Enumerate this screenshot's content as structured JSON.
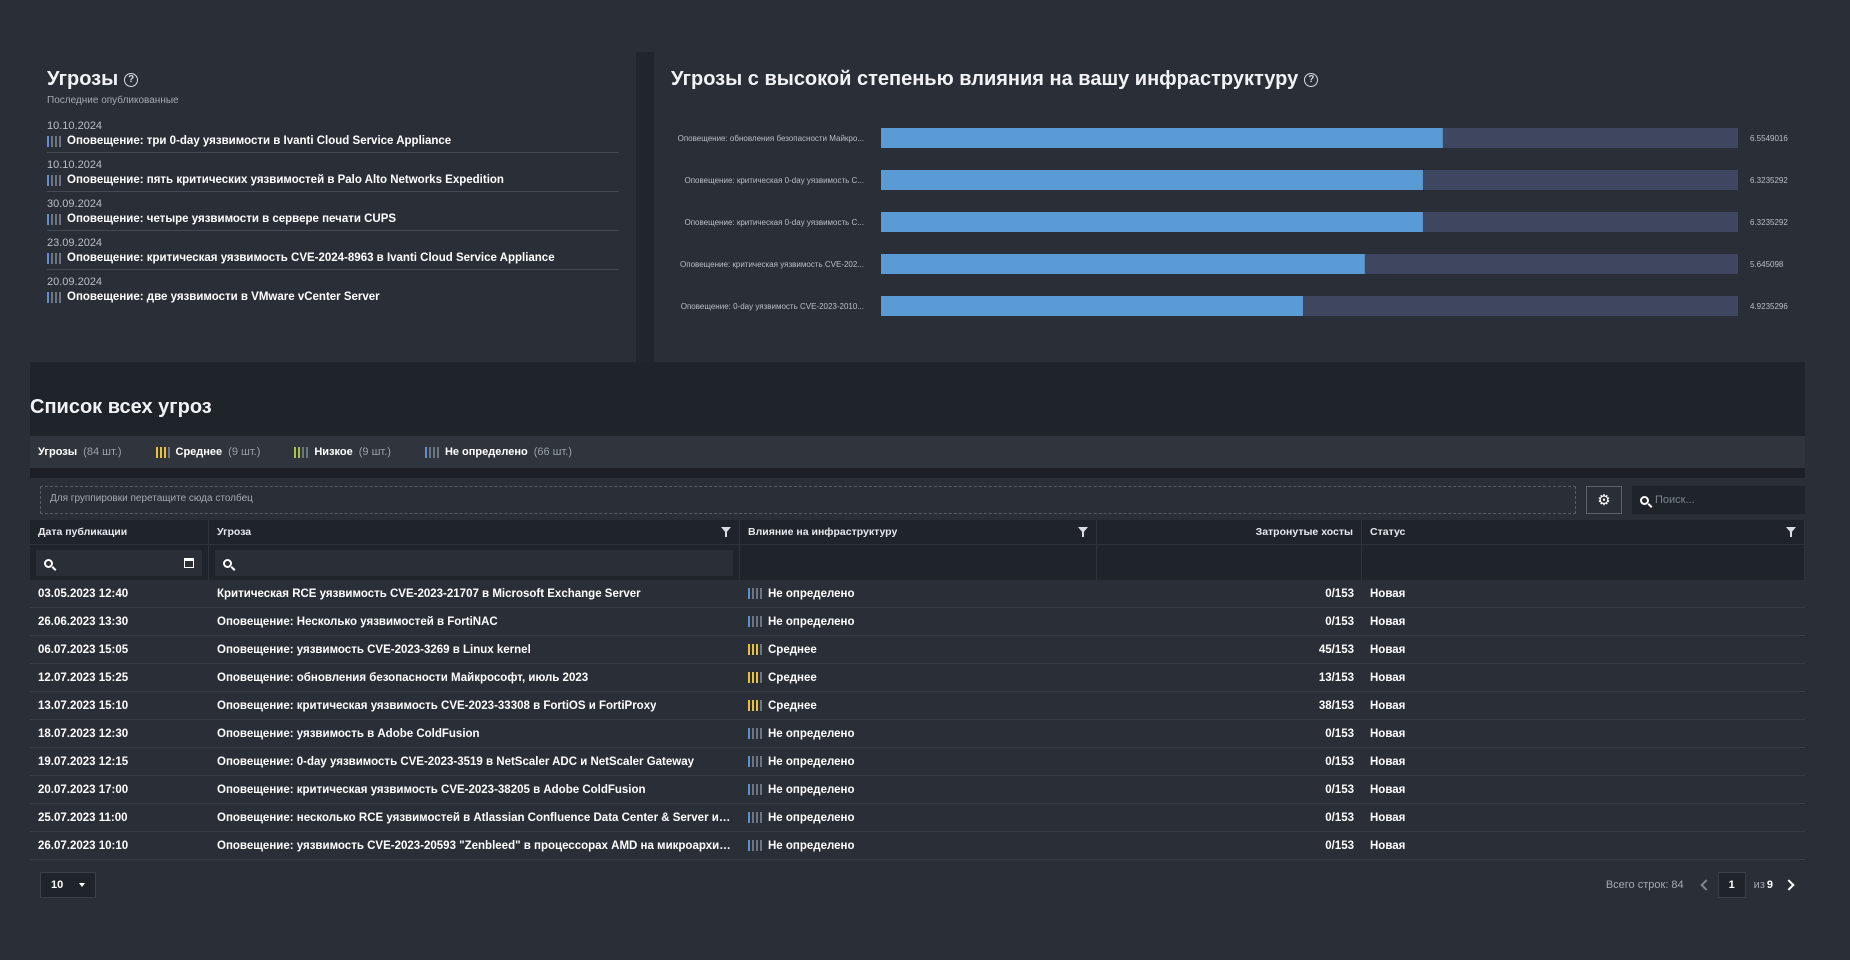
{
  "threats_panel": {
    "title": "Угрозы",
    "subtitle": "Последние опубликованные",
    "items": [
      {
        "date": "10.10.2024",
        "title": "Оповещение: три 0-day уязвимости в Ivanti Cloud Service Appliance"
      },
      {
        "date": "10.10.2024",
        "title": "Оповещение: пять критических уязвимостей в Palo Alto Networks Expedition"
      },
      {
        "date": "30.09.2024",
        "title": "Оповещение: четыре уязвимости в сервере печати CUPS"
      },
      {
        "date": "23.09.2024",
        "title": "Оповещение: критическая уязвимость CVE-2024-8963 в Ivanti Cloud Service Appliance"
      },
      {
        "date": "20.09.2024",
        "title": "Оповещение: две уязвимости в VMware vCenter Server"
      }
    ]
  },
  "chart_panel": {
    "title": "Угрозы с высокой степенью влияния на вашу инфраструктуру"
  },
  "chart_data": {
    "type": "bar",
    "orientation": "horizontal",
    "categories": [
      "Оповещение: обновления безопасности Майкро...",
      "Оповещение: критическая 0-day уязвимость C...",
      "Оповещение: критическая 0-day уязвимость C...",
      "Оповещение: критическая уязвимость CVE-202...",
      "Оповещение: 0-day уязвимость CVE-2023-2010..."
    ],
    "values": [
      6.5549016,
      6.3235292,
      6.3235292,
      5.645098,
      4.9235296
    ],
    "value_labels": [
      "6.5549016",
      "6.3235292",
      "6.3235292",
      "5.645098",
      "4.9235296"
    ],
    "xlim": [
      0,
      10
    ],
    "colors": {
      "bar": "#5b9bd5",
      "track": "#3e4660"
    }
  },
  "list": {
    "title": "Список всех угроз",
    "filters": [
      {
        "label": "Угрозы",
        "count": "(84 шт.)",
        "severity": "none"
      },
      {
        "label": "Среднее",
        "count": "(9 шт.)",
        "severity": "med"
      },
      {
        "label": "Низкое",
        "count": "(9 шт.)",
        "severity": "low"
      },
      {
        "label": "Не определено",
        "count": "(66 шт.)",
        "severity": "undef"
      }
    ],
    "group_hint": "Для группировки перетащите сюда столбец",
    "search_placeholder": "Поиск...",
    "columns": [
      "Дата публикации",
      "Угроза",
      "Влияние на инфраструктуру",
      "Затронутые хосты",
      "Статус"
    ],
    "rows": [
      {
        "date": "03.05.2023 12:40",
        "threat": "Критическая RCE уязвимость CVE-2023-21707 в Microsoft Exchange Server",
        "impact": "Не определено",
        "sev": "undef",
        "hosts": "0/153",
        "status": "Новая"
      },
      {
        "date": "26.06.2023 13:30",
        "threat": "Оповещение: Несколько уязвимостей в FortiNAC",
        "impact": "Не определено",
        "sev": "undef",
        "hosts": "0/153",
        "status": "Новая"
      },
      {
        "date": "06.07.2023 15:05",
        "threat": "Оповещение: уязвимость CVE-2023-3269 в Linux kernel",
        "impact": "Среднее",
        "sev": "med",
        "hosts": "45/153",
        "status": "Новая"
      },
      {
        "date": "12.07.2023 15:25",
        "threat": "Оповещение: обновления безопасности Майкрософт, июль 2023",
        "impact": "Среднее",
        "sev": "med",
        "hosts": "13/153",
        "status": "Новая"
      },
      {
        "date": "13.07.2023 15:10",
        "threat": "Оповещение: критическая уязвимость CVE-2023-33308 в FortiOS и FortiProxy",
        "impact": "Среднее",
        "sev": "med",
        "hosts": "38/153",
        "status": "Новая"
      },
      {
        "date": "18.07.2023 12:30",
        "threat": "Оповещение: уязвимость в Adobe ColdFusion",
        "impact": "Не определено",
        "sev": "undef",
        "hosts": "0/153",
        "status": "Новая"
      },
      {
        "date": "19.07.2023 12:15",
        "threat": "Оповещение: 0-day уязвимость CVE-2023-3519 в NetScaler ADC и NetScaler Gateway",
        "impact": "Не определено",
        "sev": "undef",
        "hosts": "0/153",
        "status": "Новая"
      },
      {
        "date": "20.07.2023 17:00",
        "threat": "Оповещение: критическая уязвимость CVE-2023-38205 в Adobe ColdFusion",
        "impact": "Не определено",
        "sev": "undef",
        "hosts": "0/153",
        "status": "Новая"
      },
      {
        "date": "25.07.2023 11:00",
        "threat": "Оповещение: несколько RCE уязвимостей в Atlassian Confluence Data Center & Server и Atlas...",
        "impact": "Не определено",
        "sev": "undef",
        "hosts": "0/153",
        "status": "Новая"
      },
      {
        "date": "26.07.2023 10:10",
        "threat": "Оповещение: уязвимость CVE-2023-20593 \"Zenbleed\" в процессорах AMD на микроархитект...",
        "impact": "Не определено",
        "sev": "undef",
        "hosts": "0/153",
        "status": "Новая"
      }
    ],
    "page_size": "10",
    "total_label": "Всего строк: 84",
    "page": "1",
    "of_label": "из",
    "total_pages": "9"
  }
}
